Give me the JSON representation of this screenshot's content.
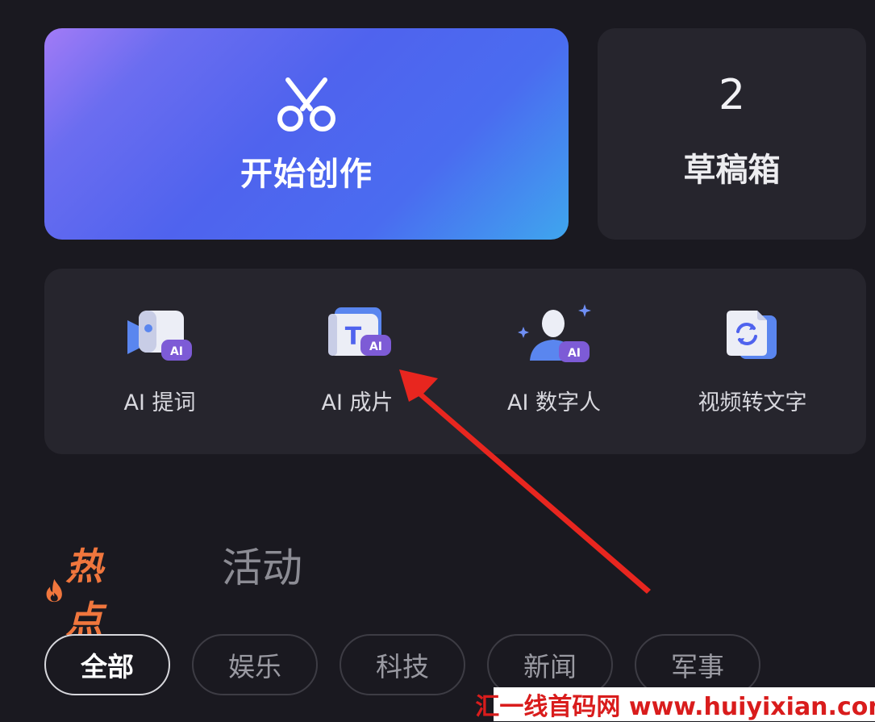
{
  "create": {
    "label": "开始创作",
    "icon": "scissors-icon"
  },
  "drafts": {
    "count": "2",
    "label": "草稿箱"
  },
  "tools": [
    {
      "label": "AI 提词",
      "icon": "ai-teleprompter-icon"
    },
    {
      "label": "AI 成片",
      "icon": "ai-text-to-video-icon"
    },
    {
      "label": "AI 数字人",
      "icon": "ai-digital-human-icon"
    },
    {
      "label": "视频转文字",
      "icon": "video-to-text-icon"
    }
  ],
  "tabs": {
    "hot": "热点",
    "activity": "活动"
  },
  "chips": [
    "全部",
    "娱乐",
    "科技",
    "新闻",
    "军事"
  ],
  "watermark": "汇一线首码网 www.huiyixian.com",
  "colors": {
    "accent": "#4f63ee",
    "hot": "#f0763d",
    "arrow": "#e8261f",
    "badge": "#7d5bd6"
  }
}
